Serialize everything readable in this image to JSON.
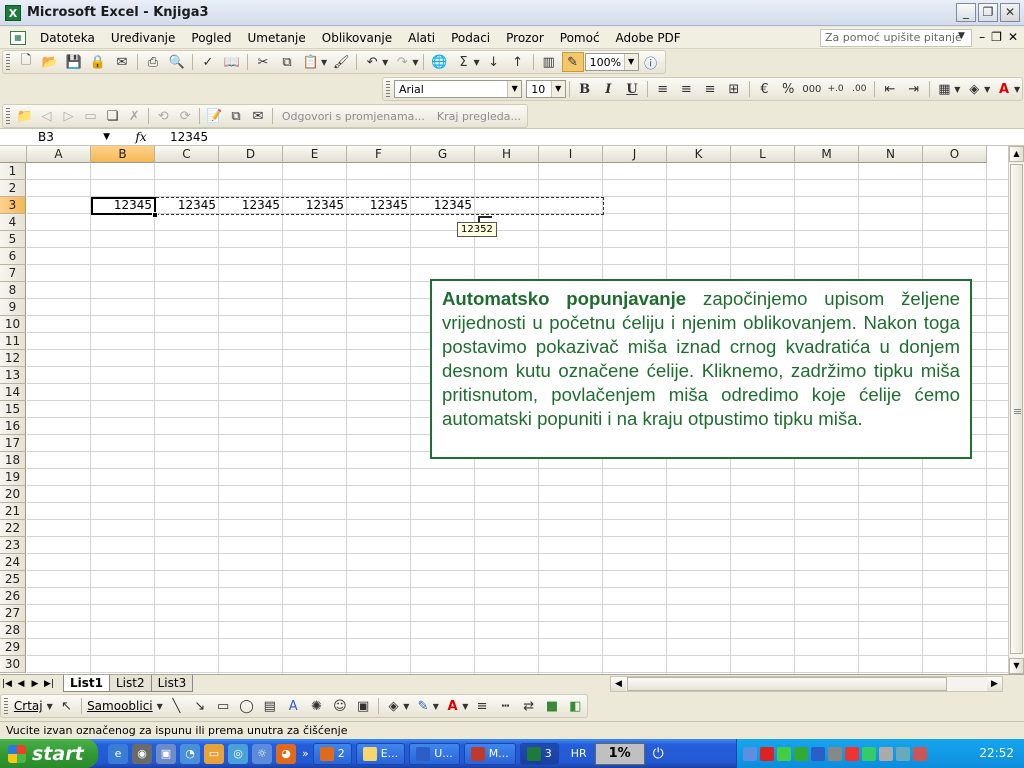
{
  "window": {
    "title": "Microsoft Excel - Knjiga3",
    "app_icon": "X"
  },
  "menu": {
    "items": [
      "Datoteka",
      "Uređivanje",
      "Pogled",
      "Umetanje",
      "Oblikovanje",
      "Alati",
      "Podaci",
      "Prozor",
      "Pomoć",
      "Adobe PDF"
    ],
    "help_placeholder": "Za pomoć upišite pitanje"
  },
  "standard_toolbar": {
    "zoom": "100%"
  },
  "formatting_toolbar": {
    "font": "Arial",
    "font_size": "10",
    "bold": "B",
    "italic": "I",
    "underline": "U",
    "percent": "%",
    "thousands": "000"
  },
  "review_toolbar": {
    "reply_label": "Odgovori s promjenama...",
    "end_review_label": "Kraj pregleda..."
  },
  "formula_bar": {
    "name_box": "B3",
    "fx": "fx",
    "value": "12345"
  },
  "grid": {
    "columns": [
      "A",
      "B",
      "C",
      "D",
      "E",
      "F",
      "G",
      "H",
      "I",
      "J",
      "K",
      "L",
      "M",
      "N",
      "O"
    ],
    "rows": [
      "1",
      "2",
      "3",
      "4",
      "5",
      "6",
      "7",
      "8",
      "9",
      "10",
      "11",
      "12",
      "13",
      "14",
      "15",
      "16",
      "17",
      "18",
      "19",
      "20",
      "21",
      "22",
      "23",
      "24",
      "25",
      "26",
      "27",
      "28",
      "29",
      "30"
    ],
    "row3_values": [
      "12345",
      "12345",
      "12345",
      "12345",
      "12345",
      "12345"
    ],
    "fill_tooltip": "12352"
  },
  "callout": {
    "lead": "Automatsko popunjavanje",
    "body": " započinjemo upisom željene vrijednosti u početnu ćeliju i njenim oblikovanjem. Nakon toga postavimo pokazivač miša iznad crnog kvadratića u donjem desnom kutu označene ćelije. Kliknemo, zadržimo tipku miša pritisnutom, povlačenjem miša odredimo koje ćelije ćemo automatski popuniti i na kraju otpustimo tipku miša."
  },
  "sheet_tabs": [
    "List1",
    "List2",
    "List3"
  ],
  "drawing_toolbar": {
    "draw_label": "Crtaj",
    "autoshapes_label": "Samooblici"
  },
  "status_bar": {
    "text": "Vucite izvan označenog za ispunu ili prema unutra za čišćenje"
  },
  "taskbar": {
    "start_label": "start",
    "tasks": [
      {
        "label": "2",
        "color": "#e06a1b"
      },
      {
        "label": "E...",
        "color": "#f5d76e"
      },
      {
        "label": "U...",
        "color": "#2b5fc5"
      },
      {
        "label": "M...",
        "color": "#c0392b"
      },
      {
        "label": "3",
        "color": "#1d7a3a"
      }
    ],
    "language": "HR",
    "cpu": "1%",
    "clock": "22:52"
  },
  "colors": {
    "callout_green": "#1d6e2e",
    "selected_header": "#f5b855",
    "taskbar_blue": "#245edb"
  }
}
